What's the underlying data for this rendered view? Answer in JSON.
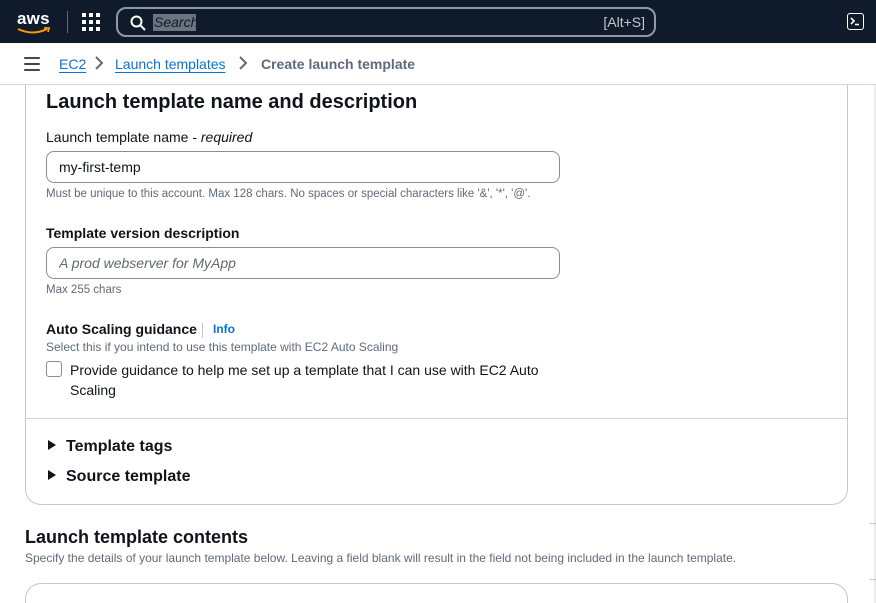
{
  "topnav": {
    "logo": "aws",
    "search_placeholder": "Search",
    "search_shortcut": "[Alt+S]"
  },
  "breadcrumb": {
    "items": [
      {
        "label": "EC2"
      },
      {
        "label": "Launch templates"
      },
      {
        "label": "Create launch template"
      }
    ]
  },
  "section1": {
    "title": "Launch template name and description",
    "name_label": "Launch template name - ",
    "name_label_required": "required",
    "name_value": "my-first-temp",
    "name_hint": "Must be unique to this account. Max 128 chars. No spaces or special characters like '&', '*', '@'.",
    "description_label": "Template version description",
    "description_placeholder": "A prod webserver for MyApp",
    "description_hint": "Max 255 chars",
    "asg_label": "Auto Scaling guidance",
    "asg_info": "Info",
    "asg_hint": "Select this if you intend to use this template with EC2 Auto Scaling",
    "asg_checkbox_label": "Provide guidance to help me set up a template that I can use with EC2 Auto Scaling",
    "asg_checked": false,
    "expanders": [
      {
        "label": "Template tags",
        "expanded": false
      },
      {
        "label": "Source template",
        "expanded": false
      }
    ]
  },
  "section2": {
    "title": "Launch template contents",
    "description": "Specify the details of your launch template below. Leaving a field blank will result in the field not being included in the launch template."
  },
  "colors": {
    "nav_bg": "#0f1b2a",
    "link": "#0972d3",
    "text": "#0f141a",
    "muted": "#5f6b7a"
  }
}
